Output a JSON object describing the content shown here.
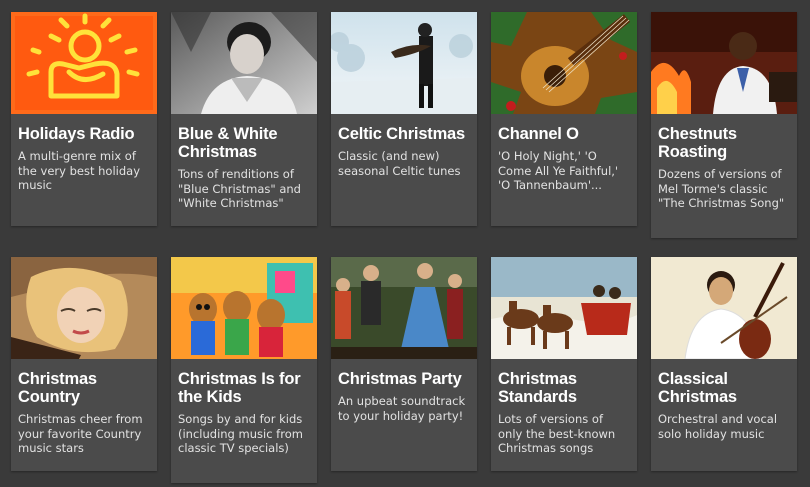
{
  "stations": [
    {
      "title": "Holidays Radio",
      "description": "A multi-genre mix of the very best holiday music",
      "art": "keith-haring-baby-icon"
    },
    {
      "title": "Blue & White Christmas",
      "description": "Tons of renditions of \"Blue Christmas\" and \"White Christmas\"",
      "art": "elvis-portrait-image"
    },
    {
      "title": "Celtic Christmas",
      "description": "Classic (and new) seasonal Celtic tunes",
      "art": "snowy-man-with-scarf-image"
    },
    {
      "title": "Channel O",
      "description": "'O Holy Night,' 'O Come All Ye Faithful,' 'O Tannenbaum'...",
      "art": "guitar-with-holly-image"
    },
    {
      "title": "Chestnuts Roasting",
      "description": "Dozens of versions of Mel Torme's classic \"The Christmas Song\"",
      "art": "singer-by-fireplace-image"
    },
    {
      "title": "Christmas Country",
      "description": "Christmas cheer from your favorite Country music stars",
      "art": "country-singer-guitar-image"
    },
    {
      "title": "Christmas Is for the Kids",
      "description": "Songs by and for kids (including music from classic TV specials)",
      "art": "chipmunks-cartoon-image"
    },
    {
      "title": "Christmas Party",
      "description": "An upbeat soundtrack to your holiday party!",
      "art": "dancing-party-image"
    },
    {
      "title": "Christmas Standards",
      "description": "Lots of versions of only the best-known Christmas songs",
      "art": "horse-sleigh-image"
    },
    {
      "title": "Classical Christmas",
      "description": "Orchestral and vocal solo holiday music",
      "art": "cellist-image"
    }
  ]
}
